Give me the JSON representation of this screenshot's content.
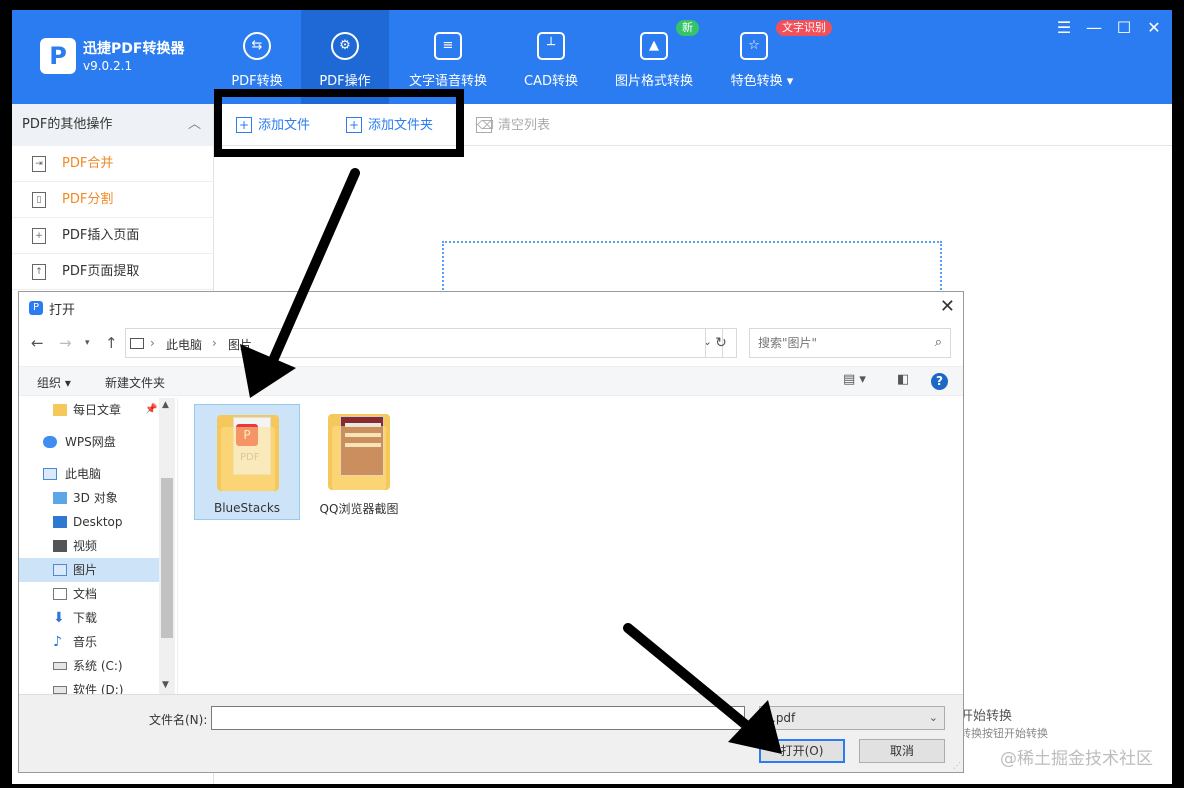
{
  "app": {
    "name": "迅捷PDF转换器",
    "version": "v9.0.2.1",
    "nav": [
      {
        "label": "PDF转换",
        "icon": "pdf-convert-icon"
      },
      {
        "label": "PDF操作",
        "icon": "pdf-operate-icon"
      },
      {
        "label": "文字语音转换",
        "icon": "voice-icon"
      },
      {
        "label": "CAD转换",
        "icon": "cad-icon"
      },
      {
        "label": "图片格式转换",
        "icon": "image-icon"
      },
      {
        "label": "特色转换",
        "icon": "special-icon"
      }
    ],
    "badge_new": "新",
    "badge_ocr": "文字识别",
    "window_controls": [
      "☰",
      "—",
      "☐",
      "✕"
    ]
  },
  "sidebar": {
    "header": "PDF的其他操作",
    "items": [
      "PDF合并",
      "PDF分割",
      "PDF插入页面",
      "PDF页面提取"
    ]
  },
  "toolbar": {
    "add_file": "添加文件",
    "add_folder": "添加文件夹",
    "clear_list": "清空列表"
  },
  "main": {
    "hint_title": "开始转换",
    "hint_sub": "转换按钮开始转换"
  },
  "dialog": {
    "title": "打开",
    "breadcrumb": [
      "此电脑",
      "图片"
    ],
    "search_placeholder": "搜索\"图片\"",
    "organize": "组织 ▾",
    "new_folder": "新建文件夹",
    "tree": [
      {
        "label": "每日文章",
        "icon": "folder-icon",
        "pinned": true
      },
      {
        "label": "WPS网盘",
        "icon": "cloud-icon"
      },
      {
        "label": "此电脑",
        "icon": "computer-icon"
      },
      {
        "label": "3D 对象",
        "icon": "cube-icon"
      },
      {
        "label": "Desktop",
        "icon": "desktop-icon"
      },
      {
        "label": "视频",
        "icon": "video-icon"
      },
      {
        "label": "图片",
        "icon": "picture-icon",
        "selected": true
      },
      {
        "label": "文档",
        "icon": "document-icon"
      },
      {
        "label": "下载",
        "icon": "download-icon"
      },
      {
        "label": "音乐",
        "icon": "music-icon"
      },
      {
        "label": "系统 (C:)",
        "icon": "drive-icon"
      },
      {
        "label": "软件 (D:)",
        "icon": "drive-icon"
      }
    ],
    "files": [
      {
        "name": "BlueStacks",
        "selected": true
      },
      {
        "name": "QQ浏览器截图",
        "selected": false
      }
    ],
    "filename_label": "文件名(N):",
    "filename_value": "",
    "filter_value": "*.pdf",
    "open_button": "打开(O)",
    "cancel_button": "取消"
  },
  "watermark": "@稀土掘金技术社区",
  "colors": {
    "brand_blue": "#2b7cf0",
    "active_nav": "#1f69d6",
    "orange": "#f08a24",
    "badge_green": "#35c46a",
    "badge_red": "#f0505a",
    "selection": "#cce3f8"
  }
}
